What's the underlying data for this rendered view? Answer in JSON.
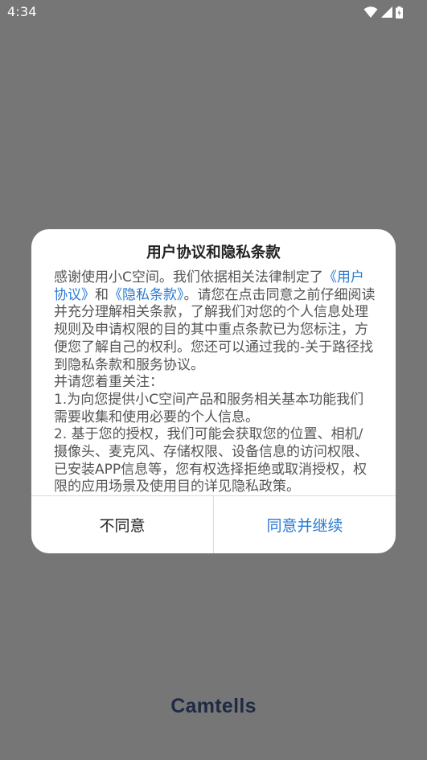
{
  "status_bar": {
    "time": "4:34",
    "icons": [
      "wifi-icon",
      "cellular-signal-icon",
      "battery-icon"
    ]
  },
  "dialog": {
    "title": "用户协议和隐私条款",
    "body": {
      "intro": "感谢使用小C空间。我们依据相关法律制定了",
      "link_user_agreement": "《用户协议》",
      "and": "和",
      "link_privacy": "《隐私条款》",
      "para_1": "。请您在点击同意之前仔细阅读并充分理解相关条款，了解我们对您的个人信息处理规则及申请权限的目的其中重点条款已为您标注，方便您了解自己的权利。您还可以通过我的-关于路径找到隐私条款和服务协议。",
      "para_2": "并请您着重关注：",
      "item_1": "1.为向您提供小C空间产品和服务相关基本功能我们需要收集和使用必要的个人信息。",
      "item_2": "2. 基于您的授权，我们可能会获取您的位置、相机/摄像头、麦克风、存储权限、设备信息的访问权限、已安装APP信息等，您有权选择拒绝或取消授权，权限的应用场景及使用目的详见隐私政策。"
    },
    "buttons": {
      "decline": "不同意",
      "agree": "同意并继续"
    }
  },
  "brand": {
    "logo_text": "Camtells"
  },
  "colors": {
    "scrim": "#767676",
    "link": "#2a7ad0",
    "brand": "#1f2a44"
  }
}
